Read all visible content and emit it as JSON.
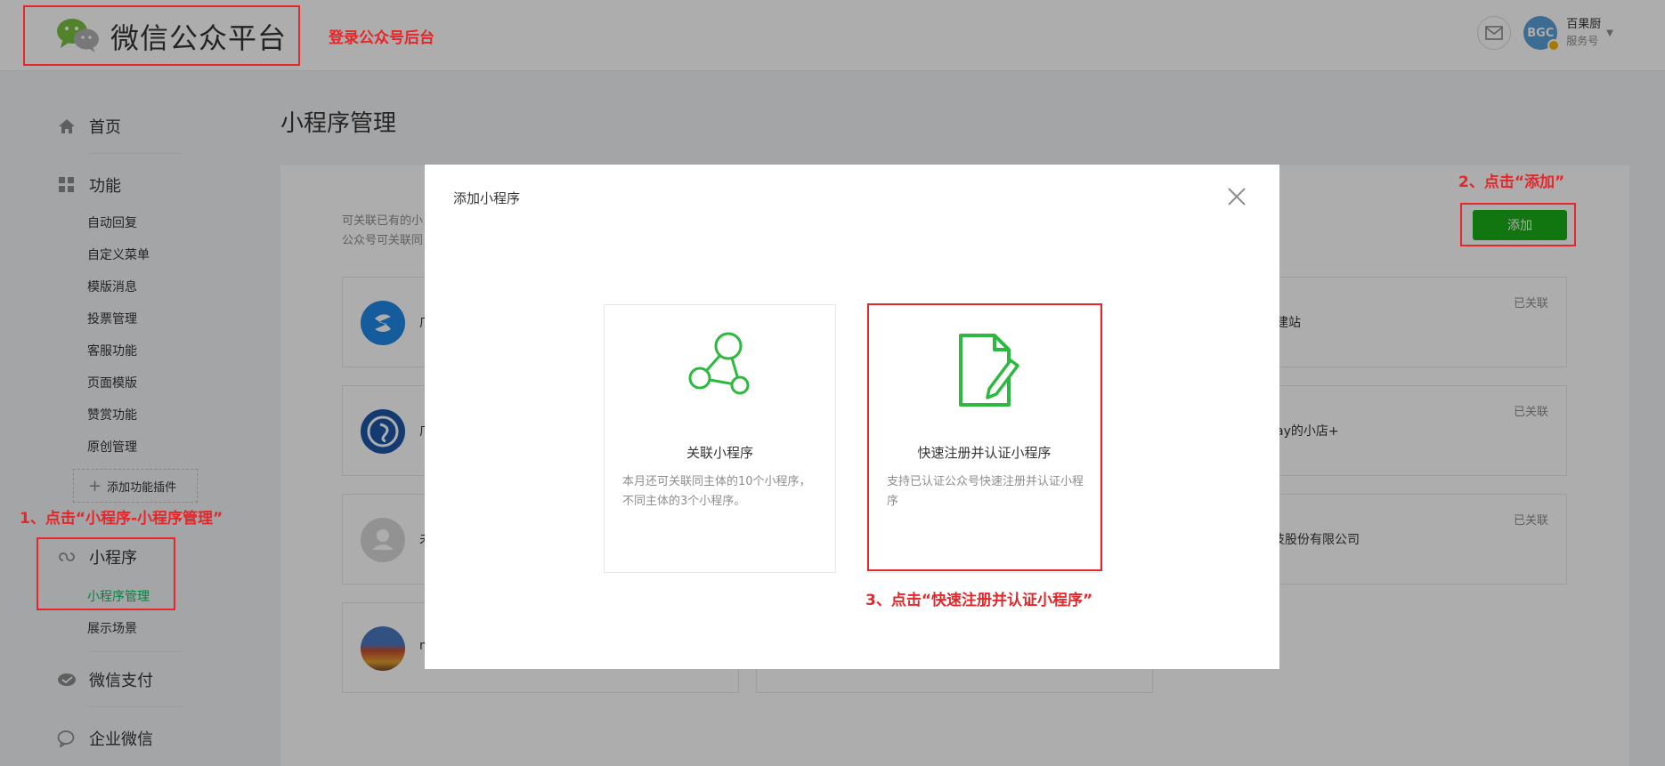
{
  "header": {
    "logo_text": "微信公众平台",
    "account_name": "百果厨",
    "account_type": "服务号",
    "avatar_text": "BGC"
  },
  "sidebar": {
    "home": "首页",
    "features": "功能",
    "feature_items": [
      "自动回复",
      "自定义菜单",
      "模版消息",
      "投票管理",
      "客服功能",
      "页面模版",
      "赞赏功能",
      "原创管理"
    ],
    "add_plugin": "添加功能插件",
    "miniprogram": "小程序",
    "miniprogram_items": [
      "小程序管理",
      "展示场景"
    ],
    "wechat_pay": "微信支付",
    "work_wechat": "企业微信"
  },
  "main": {
    "page_title": "小程序管理",
    "intro_lines": [
      "可关联已有的小",
      "公众号可关联同"
    ],
    "add_button": "添加",
    "cards": [
      {
        "name": "广",
        "name_right": "建站",
        "status": "已关联"
      },
      {
        "name": "广",
        "name_right": "ay的小店+",
        "status": "已关联"
      },
      {
        "name": "未",
        "name_right": "讯科互联网科技股份有限公司",
        "status": "已关联"
      },
      {
        "name": "m",
        "name_right": "",
        "status": ""
      }
    ]
  },
  "modal": {
    "title": "添加小程序",
    "options": [
      {
        "title": "关联小程序",
        "desc": "本月还可关联同主体的10个小程序，不同主体的3个小程序。"
      },
      {
        "title": "快速注册并认证小程序",
        "desc": "支持已认证公众号快速注册并认证小程序"
      }
    ]
  },
  "annotations": {
    "login": "登录公众号后台",
    "step1": "1、点击“小程序-小程序管理”",
    "step2": "2、点击“添加”",
    "step3": "3、点击“快速注册并认证小程序”"
  },
  "colors": {
    "brand_green": "#1aad19",
    "active_green": "#07c160",
    "annotation_red": "#e5262a"
  }
}
